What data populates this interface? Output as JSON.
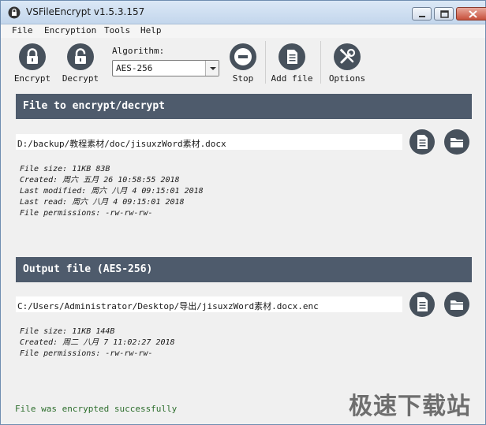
{
  "window": {
    "title": "VSFileEncrypt v1.5.3.157"
  },
  "menu": {
    "items": [
      "File",
      "Encryption",
      "Tools",
      "Help"
    ]
  },
  "toolbar": {
    "encrypt_label": "Encrypt",
    "decrypt_label": "Decrypt",
    "algorithm_label": "Algorithm:",
    "algorithm_value": "AES-256",
    "stop_label": "Stop",
    "add_file_label": "Add file",
    "options_label": "Options"
  },
  "input_section": {
    "header": "File to encrypt/decrypt",
    "path": "D:/backup/教程素材/doc/jisuxzWord素材.docx",
    "info": [
      "File size: 11KB 83B",
      "Created: 周六 五月 26 10:58:55 2018",
      "Last modified: 周六 八月 4 09:15:01 2018",
      "Last read: 周六 八月 4 09:15:01 2018",
      "File permissions: -rw-rw-rw-"
    ]
  },
  "output_section": {
    "header": "Output file (AES-256)",
    "path": "C:/Users/Administrator/Desktop/导出/jisuxzWord素材.docx.enc",
    "info": [
      "File size: 11KB 144B",
      "Created: 周二 八月 7 11:02:27 2018",
      "File permissions: -rw-rw-rw-"
    ]
  },
  "status": {
    "text": "File was encrypted successfully"
  },
  "watermark": {
    "text": "极速下载站"
  },
  "colors": {
    "header_bg": "#4e5b6c",
    "icon_bg": "#47515c",
    "status_text": "#2d6e2d"
  }
}
